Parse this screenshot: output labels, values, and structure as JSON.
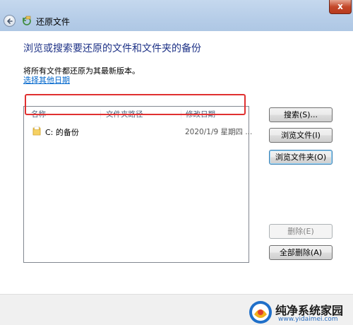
{
  "window": {
    "title": "还原文件",
    "close_label": "x"
  },
  "page": {
    "heading": "浏览或搜索要还原的文件和文件夹的备份",
    "description": "将所有文件都还原为其最新版本。",
    "choose_date_link": "选择其他日期"
  },
  "list": {
    "columns": [
      "名称",
      "文件夹路径",
      "修改日期"
    ],
    "rows": [
      {
        "name": "C: 的备份",
        "path": "",
        "modified": "2020/1/9 星期四 ..."
      }
    ]
  },
  "buttons": {
    "search": "搜索(S)...",
    "browse_files": "浏览文件(I)",
    "browse_folders": "浏览文件夹(O)",
    "remove": "删除(E)",
    "remove_all": "全部删除(A)"
  },
  "watermark": {
    "name": "纯净系统家园",
    "url": "www.yidaimei.com"
  },
  "colors": {
    "heading": "#1e3287",
    "link": "#0066cc",
    "highlight": "#e03030"
  }
}
